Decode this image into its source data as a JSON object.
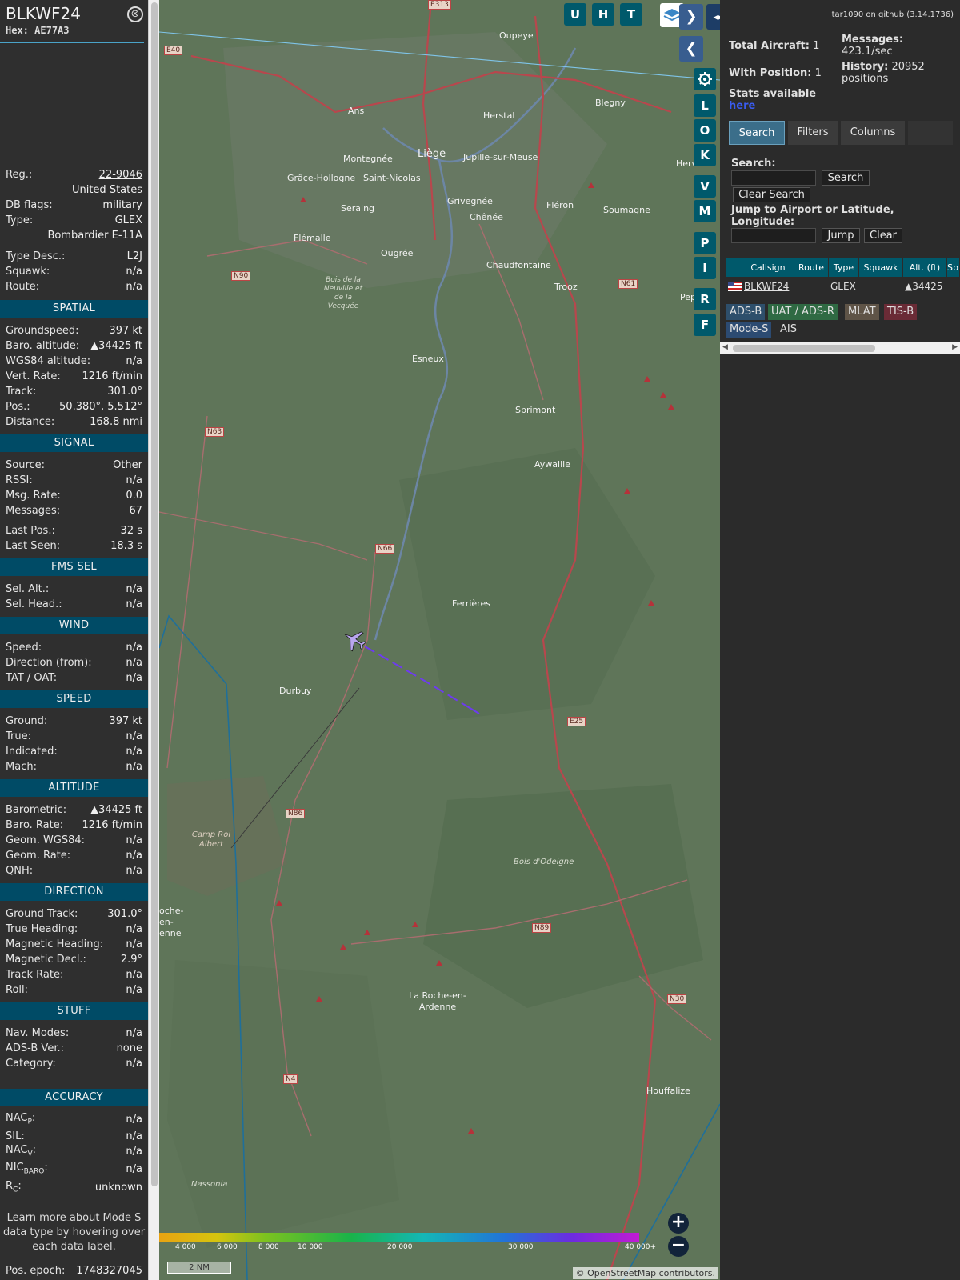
{
  "aircraft": {
    "callsign": "BLKWF24",
    "hex_label": "Hex:",
    "hex": "AE77A3",
    "close_glyph": "⊗"
  },
  "info_rows": {
    "reg_label": "Reg.:",
    "reg": "22-9046",
    "country": "United States",
    "dbflags_label": "DB flags:",
    "dbflags": "military",
    "type_label": "Type:",
    "type": "GLEX",
    "type_name": "Bombardier E-11A",
    "typedesc_label": "Type Desc.:",
    "typedesc": "L2J",
    "squawk_label": "Squawk:",
    "squawk": "n/a",
    "route_label": "Route:",
    "route": "n/a"
  },
  "sections": {
    "spatial": "SPATIAL",
    "signal": "SIGNAL",
    "fms": "FMS SEL",
    "wind": "WIND",
    "speed": "SPEED",
    "altitude": "ALTITUDE",
    "direction": "DIRECTION",
    "stuff": "STUFF",
    "accuracy": "ACCURACY"
  },
  "spatial": {
    "gs_label": "Groundspeed:",
    "gs": "397 kt",
    "baro_label": "Baro. altitude:",
    "baro": "▲34425 ft",
    "wgs_label": "WGS84 altitude:",
    "wgs": "n/a",
    "vr_label": "Vert. Rate:",
    "vr": "1216 ft/min",
    "track_label": "Track:",
    "track": "301.0°",
    "pos_label": "Pos.:",
    "pos": "50.380°, 5.512°",
    "dist_label": "Distance:",
    "dist": "168.8 nmi"
  },
  "signal": {
    "source_label": "Source:",
    "source": "Other",
    "rssi_label": "RSSI:",
    "rssi": "n/a",
    "msgrate_label": "Msg. Rate:",
    "msgrate": "0.0",
    "messages_label": "Messages:",
    "messages": "67",
    "lastpos_label": "Last Pos.:",
    "lastpos": "32 s",
    "lastseen_label": "Last Seen:",
    "lastseen": "18.3 s"
  },
  "fms": {
    "selalt_label": "Sel. Alt.:",
    "selalt": "n/a",
    "selhead_label": "Sel. Head.:",
    "selhead": "n/a"
  },
  "wind": {
    "speed_label": "Speed:",
    "speed": "n/a",
    "dir_label": "Direction (from):",
    "dir": "n/a",
    "tat_label": "TAT / OAT:",
    "tat": "n/a"
  },
  "speed": {
    "ground_label": "Ground:",
    "ground": "397 kt",
    "true_label": "True:",
    "true": "n/a",
    "ind_label": "Indicated:",
    "ind": "n/a",
    "mach_label": "Mach:",
    "mach": "n/a"
  },
  "altitude": {
    "baro_label": "Barometric:",
    "baro": "▲34425 ft",
    "barorate_label": "Baro. Rate:",
    "barorate": "1216 ft/min",
    "geom_label": "Geom. WGS84:",
    "geom": "n/a",
    "geomrate_label": "Geom. Rate:",
    "geomrate": "n/a",
    "qnh_label": "QNH:",
    "qnh": "n/a"
  },
  "direction": {
    "gt_label": "Ground Track:",
    "gt": "301.0°",
    "th_label": "True Heading:",
    "th": "n/a",
    "mh_label": "Magnetic Heading:",
    "mh": "n/a",
    "md_label": "Magnetic Decl.:",
    "md": "2.9°",
    "tr_label": "Track Rate:",
    "tr": "n/a",
    "roll_label": "Roll:",
    "roll": "n/a"
  },
  "stuff": {
    "nav_label": "Nav. Modes:",
    "nav": "n/a",
    "adsb_label": "ADS-B Ver.:",
    "adsb": "none",
    "cat_label": "Category:",
    "cat": "n/a"
  },
  "accuracy": {
    "nacp_main": "NAC",
    "nacp_sub": "P",
    "nacp": "n/a",
    "sil_label": "SIL:",
    "sil": "n/a",
    "nacv_main": "NAC",
    "nacv_sub": "V",
    "nacv": "n/a",
    "nicbaro_main": "NIC",
    "nicbaro_sub": "BARO",
    "nicbaro": "n/a",
    "rc_main": "R",
    "rc_sub": "C",
    "rc": "unknown"
  },
  "note": "Learn more about Mode S data type by hovering over each data label.",
  "epoch_label": "Pos. epoch:",
  "epoch": "1748327045",
  "map_buttons": {
    "u": "U",
    "h": "H",
    "t": "T",
    "l": "L",
    "o": "O",
    "k": "K",
    "v": "V",
    "m": "M",
    "p": "P",
    "i": "I",
    "r": "R",
    "f": "F",
    "next": "❯",
    "prev": "❮",
    "expand": "◂▸",
    "zoom_in": "+",
    "zoom_out": "−"
  },
  "places": [
    {
      "name": "Oupeye"
    },
    {
      "name": "Herstal"
    },
    {
      "name": "Blegny"
    },
    {
      "name": "Liège"
    },
    {
      "name": "Ans"
    },
    {
      "name": "Montegnée"
    },
    {
      "name": "Saint-Nicolas"
    },
    {
      "name": "Grâce-Hollogne"
    },
    {
      "name": "Jupille-sur-Meuse"
    },
    {
      "name": "Seraing"
    },
    {
      "name": "Grivegnée"
    },
    {
      "name": "Chênée"
    },
    {
      "name": "Fléron"
    },
    {
      "name": "Soumagne"
    },
    {
      "name": "Flémalle"
    },
    {
      "name": "Ougrée"
    },
    {
      "name": "Chaudfontaine"
    },
    {
      "name": "Trooz"
    },
    {
      "name": "Esneux"
    },
    {
      "name": "Sprimont"
    },
    {
      "name": "Aywaille"
    },
    {
      "name": "Ferrières"
    },
    {
      "name": "Durbuy"
    },
    {
      "name": "La Roche-en-Ardenne"
    },
    {
      "name": "Houffalize"
    },
    {
      "name": "Herve"
    },
    {
      "name": "Pep"
    }
  ],
  "roads": {
    "e313": "E313",
    "e40": "E40",
    "n90": "N90",
    "n63": "N63",
    "n66": "N66",
    "n86": "N86",
    "n89": "N89",
    "n4": "N4",
    "n30": "N30",
    "e25": "E25",
    "n61": "N61"
  },
  "map_features": {
    "bois_neuville": "Bois de la Neuville et de la Vecquée",
    "camp_roi": "Camp Roi Albert",
    "bois_odeigne": "Bois d'Odeigne",
    "nassonia": "Nassonia",
    "roche_en": "oche-en- enne"
  },
  "altitude_legend": [
    "4 000",
    "6 000",
    "8 000",
    "10 000",
    "20 000",
    "30 000",
    "40 000+"
  ],
  "scale_label": "2 NM",
  "attribution_prefix": "© ",
  "attribution_link": "OpenStreetMap",
  "attribution_suffix": " contributors.",
  "right_panel": {
    "github": "tar1090 on github (3.14.1736)",
    "total_label": "Total Aircraft:",
    "total": "1",
    "messages_label": "Messages:",
    "messages": "423.1/sec",
    "withpos_label": "With Position:",
    "withpos": "1",
    "history_label": "History:",
    "history": "20952 positions",
    "stats_label": "Stats available",
    "stats_link": "here",
    "tabs": [
      "Search",
      "Filters",
      "Columns"
    ],
    "search_label": "Search:",
    "search_btn": "Search",
    "clear_search": "Clear Search",
    "jump_label": "Jump to Airport or Latitude, Longitude:",
    "jump_btn": "Jump",
    "clear_btn": "Clear",
    "columns": [
      "Callsign",
      "Route",
      "Type",
      "Squawk",
      "Alt. (ft)",
      "Sp"
    ],
    "table_rows": [
      {
        "callsign": "BLKWF24",
        "route": "",
        "type": "GLEX",
        "squawk": "",
        "alt": "▲34425"
      }
    ],
    "source_chips": [
      "ADS-B",
      "UAT / ADS-R",
      "MLAT",
      "TIS-B",
      "Mode-S",
      "AIS"
    ]
  },
  "colors": {
    "section_bg": "#004b66",
    "button_teal": "#00596b",
    "adsb": "#2e4f6b",
    "uat": "#2f6a43",
    "mlat": "#5f5447",
    "tisb": "#6a2b36",
    "modes": "#2c4b72"
  }
}
